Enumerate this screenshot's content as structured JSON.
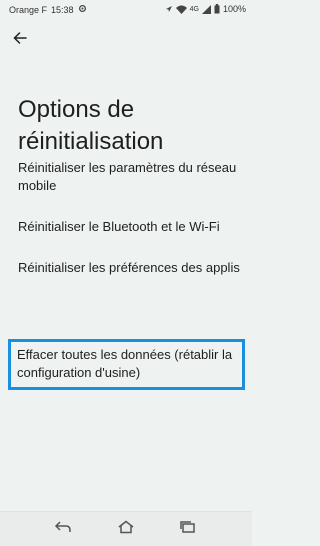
{
  "status_bar": {
    "carrier": "Orange F",
    "time": "15:38",
    "network": "4G",
    "battery": "100%"
  },
  "header": {
    "back_icon": "arrow-left-icon"
  },
  "title": "Options de réinitialisation",
  "options": [
    {
      "label": "Réinitialiser les paramètres du réseau mobile"
    },
    {
      "label": "Réinitialiser le Bluetooth et le Wi-Fi"
    },
    {
      "label": "Réinitialiser les préférences des applis"
    },
    {
      "label": "Effacer toutes les données (rétablir la configuration d'usine)",
      "highlighted": true
    }
  ],
  "nav_bar": {
    "icons": [
      "back-icon",
      "home-icon",
      "recents-icon"
    ]
  },
  "colors": {
    "background": "#eef2f1",
    "highlight": "#1a8fe0"
  }
}
